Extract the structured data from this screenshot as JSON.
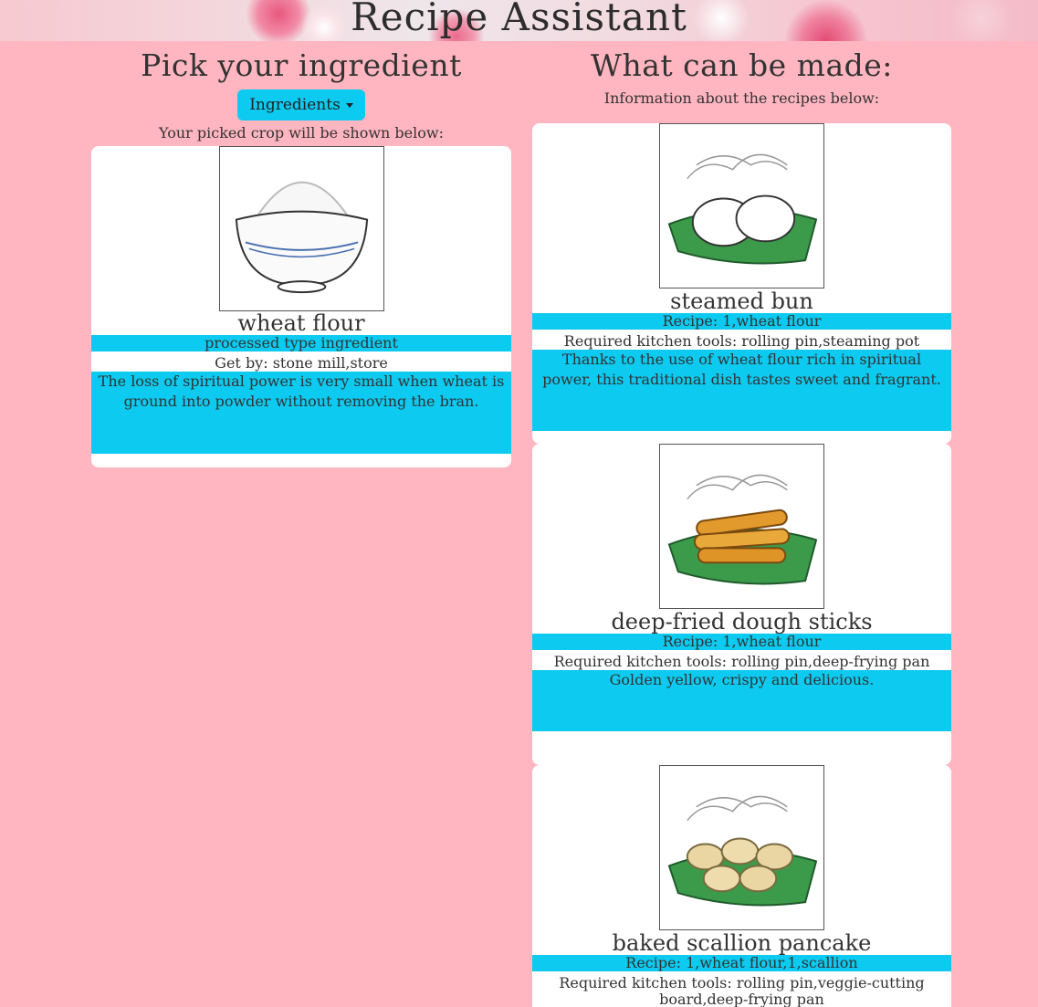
{
  "header": {
    "title": "Recipe Assistant"
  },
  "left": {
    "title": "Pick your ingredient",
    "dropdown_label": "Ingredients",
    "caption": "Your picked crop will be shown below:",
    "ingredient": {
      "name": "wheat flour",
      "type": "processed type ingredient",
      "get_by": "Get by: stone mill,store",
      "description": "The loss of spiritual power is very small when wheat is ground into powder without removing the bran.",
      "image": "flour-bowl-image"
    }
  },
  "right": {
    "title": "What can be made:",
    "caption": "Information about the recipes below:",
    "recipes": [
      {
        "name": "steamed bun",
        "recipe": "Recipe: 1,wheat flour",
        "tools": "Required kitchen tools: rolling pin,steaming pot",
        "description": "Thanks to the use of wheat flour rich in spiritual power, this traditional dish tastes sweet and fragrant.",
        "image": "steamed-bun-image"
      },
      {
        "name": "deep-fried dough sticks",
        "recipe": "Recipe: 1,wheat flour",
        "tools": "Required kitchen tools: rolling pin,deep-frying pan",
        "description": "Golden yellow, crispy and delicious.",
        "image": "dough-sticks-image"
      },
      {
        "name": "baked scallion pancake",
        "recipe": "Recipe: 1,wheat flour,1,scallion",
        "tools": "Required kitchen tools: rolling pin,veggie-cutting board,deep-frying pan",
        "image": "scallion-pancake-image"
      }
    ]
  },
  "colors": {
    "background": "#ffb6c1",
    "accent": "#0dcaf0",
    "card": "#ffffff"
  }
}
